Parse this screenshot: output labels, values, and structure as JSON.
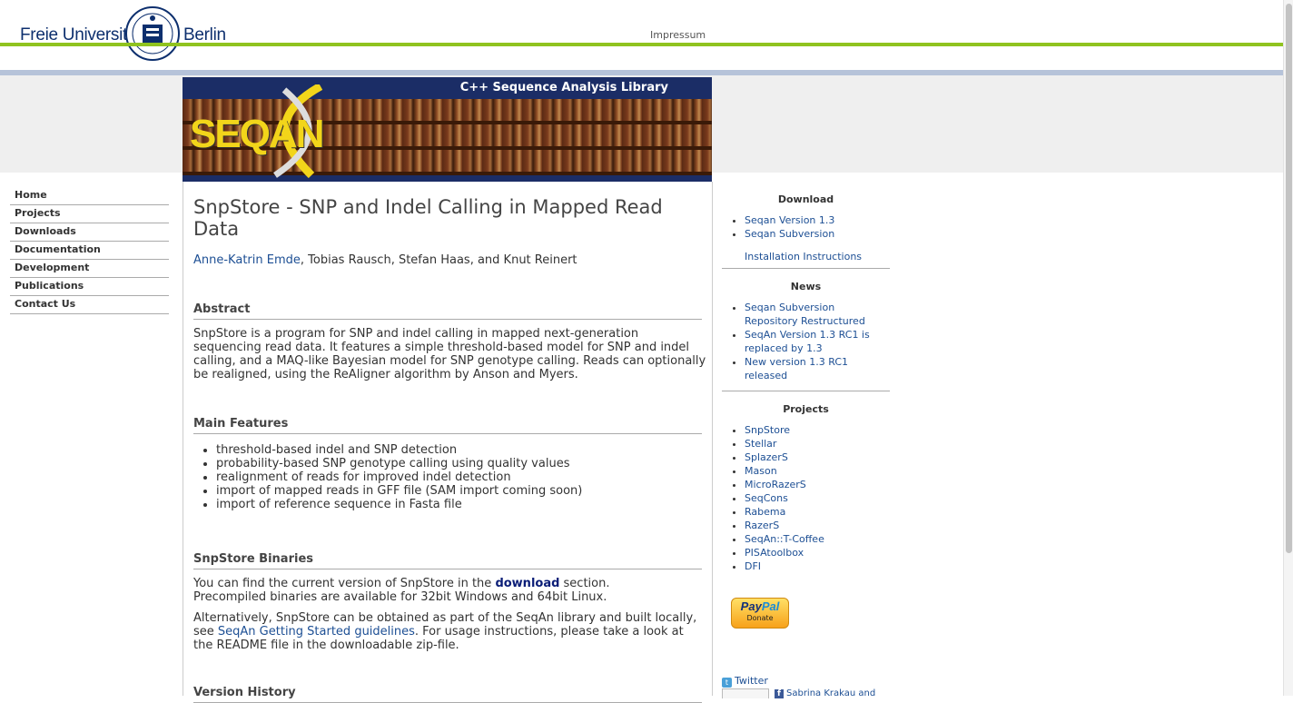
{
  "header": {
    "fu_left": "Freie Universität",
    "fu_right": "Berlin",
    "impressum": "Impressum"
  },
  "banner": {
    "title": "C++ Sequence Analysis Library",
    "logo": "SEQAN"
  },
  "left_nav": {
    "items": [
      "Home",
      "Projects",
      "Downloads",
      "Documentation",
      "Development",
      "Publications",
      "Contact Us"
    ]
  },
  "main": {
    "title": "SnpStore - SNP and Indel Calling in Mapped Read Data",
    "authors_link": "Anne-Katrin Emde",
    "authors_rest": ", Tobias Rausch, Stefan Haas, and Knut Reinert",
    "abstract_heading": "Abstract",
    "abstract_text": "SnpStore is a program for SNP and indel calling in mapped next-generation sequencing read data. It features a simple threshold-based model for SNP and indel calling, and a MAQ-like Bayesian model for SNP genotype calling. Reads can optionally be realigned, using the ReAligner algorithm by Anson and Myers.",
    "features_heading": "Main Features",
    "features": [
      "threshold-based indel and SNP detection",
      "probability-based SNP genotype calling using quality values",
      "realignment of reads for improved indel detection",
      "import of mapped reads in GFF file (SAM import coming soon)",
      "import of reference sequence in Fasta file"
    ],
    "binaries_heading": "SnpStore Binaries",
    "binaries_p1_a": "You can find the current version of SnpStore in the ",
    "binaries_p1_link": "download",
    "binaries_p1_b": " section.",
    "binaries_p1_c": "Precompiled binaries are available for 32bit Windows and 64bit Linux.",
    "binaries_p2_a": "Alternatively, SnpStore can be obtained as part of the SeqAn library and built locally, see ",
    "binaries_p2_link": "SeqAn Getting Started guidelines",
    "binaries_p2_b": ". For usage instructions, please take a look at the README file in the downloadable zip-file.",
    "version_heading": "Version History"
  },
  "right": {
    "download_heading": "Download",
    "download_items": [
      "Seqan Version 1.3",
      "Seqan Subversion"
    ],
    "install_link": "Installation Instructions",
    "news_heading": "News",
    "news_items": [
      "Seqan Subversion Repository Restructured",
      "SeqAn Version 1.3 RC1 is replaced by 1.3",
      "New version 1.3 RC1 released"
    ],
    "projects_heading": "Projects",
    "projects_items": [
      "SnpStore",
      "Stellar",
      "SplazerS",
      "Mason",
      "MicroRazerS",
      "SeqCons",
      "Rabema",
      "RazerS",
      "SeqAn::T-Coffee",
      "PISAtoolbox",
      "DFI"
    ],
    "paypal_logo": "PayPal",
    "paypal_donate": "Donate",
    "twitter": "Twitter",
    "facebook_text": "Sabrina Krakau and"
  }
}
